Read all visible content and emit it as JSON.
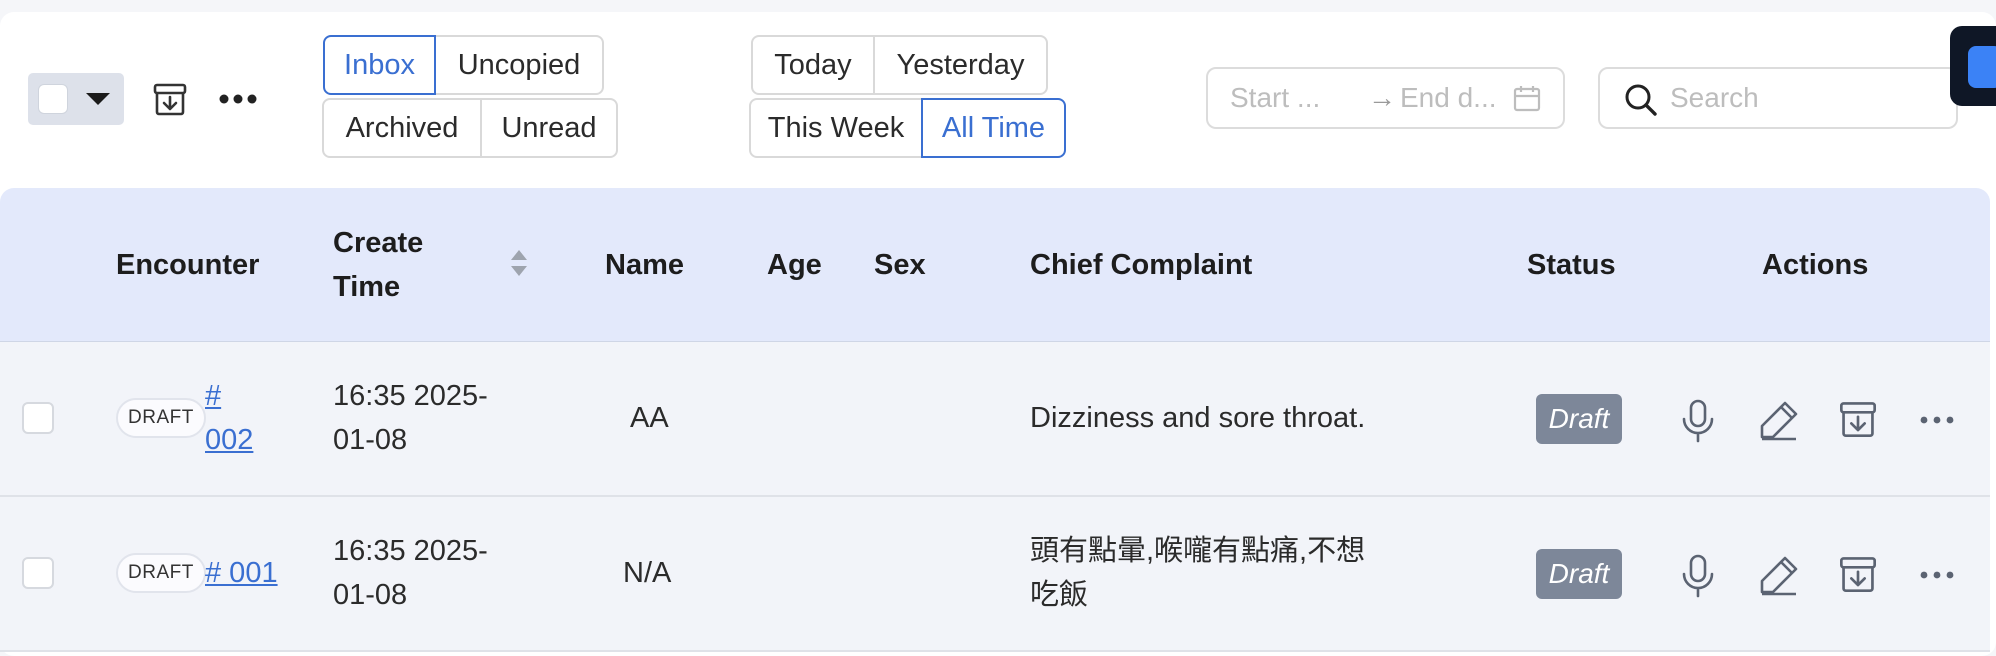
{
  "toolbar": {
    "select_all_dropdown": "chevron-down-icon",
    "export_icon": "archive-download-icon",
    "more_icon": "more-horizontal-icon"
  },
  "filters": {
    "folders": [
      "Inbox",
      "Uncopied",
      "Archived",
      "Unread"
    ],
    "folders_selected": "Inbox",
    "periods": [
      "Today",
      "Yesterday",
      "This Week",
      "All Time"
    ],
    "periods_selected": "All Time"
  },
  "date_range": {
    "start_placeholder": "Start ...",
    "end_placeholder": "End d...",
    "arrow": "→"
  },
  "search": {
    "placeholder": "Search"
  },
  "table": {
    "headers": {
      "encounter": "Encounter",
      "create_time": "Create Time",
      "name": "Name",
      "age": "Age",
      "sex": "Sex",
      "chief_complaint": "Chief Complaint",
      "status": "Status",
      "actions": "Actions"
    },
    "rows": [
      {
        "tag": "DRAFT",
        "encounter": "# 002",
        "create_time": "16:35 2025-01-08",
        "name": "AA",
        "age": "",
        "sex": "",
        "chief_complaint": "Dizziness and sore throat.",
        "status": "Draft"
      },
      {
        "tag": "DRAFT",
        "encounter": "# 001",
        "create_time": "16:35 2025-01-08",
        "name": "N/A",
        "age": "",
        "sex": "",
        "chief_complaint": "頭有點暈,喉嚨有點痛,不想吃飯",
        "status": "Draft"
      }
    ],
    "row_action_icons": [
      "microphone-icon",
      "edit-icon",
      "archive-download-icon",
      "more-horizontal-icon"
    ]
  },
  "colors": {
    "accent": "#3a6fd1",
    "header_bg": "#e3e9fb",
    "row_bg": "#f2f4f9",
    "status_badge": "#7d8799"
  }
}
